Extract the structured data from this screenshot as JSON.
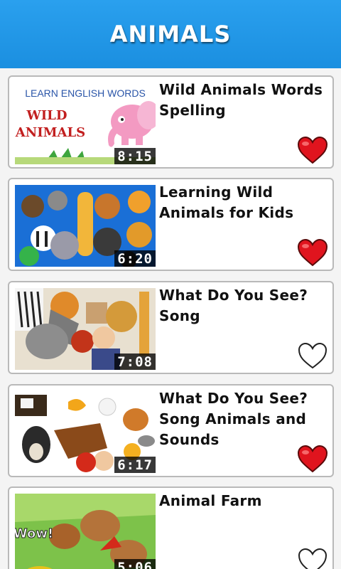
{
  "header": {
    "title": "ANIMALS"
  },
  "videos": [
    {
      "title": "Wild Animals Words Spelling",
      "duration": "8:15",
      "favorite": true,
      "thumb_text": {
        "line1": "LEARN ENGLISH WORDS",
        "line2": "WILD",
        "line3": "ANIMALS"
      }
    },
    {
      "title": "Learning Wild Animals for Kids",
      "duration": "6:20",
      "favorite": true
    },
    {
      "title": "What Do You See? Song",
      "duration": "7:08",
      "favorite": false
    },
    {
      "title": "What Do You See? Song Animals and Sounds",
      "duration": "6:17",
      "favorite": true
    },
    {
      "title": "Animal Farm",
      "duration": "5:06",
      "favorite": false,
      "thumb_text": {
        "caption": "Wow!"
      }
    }
  ],
  "colors": {
    "header": "#1b8fe0",
    "heart_fill": "#e0141e",
    "heart_outline": "#222222"
  },
  "icons": {
    "favorite": "heart-icon"
  }
}
